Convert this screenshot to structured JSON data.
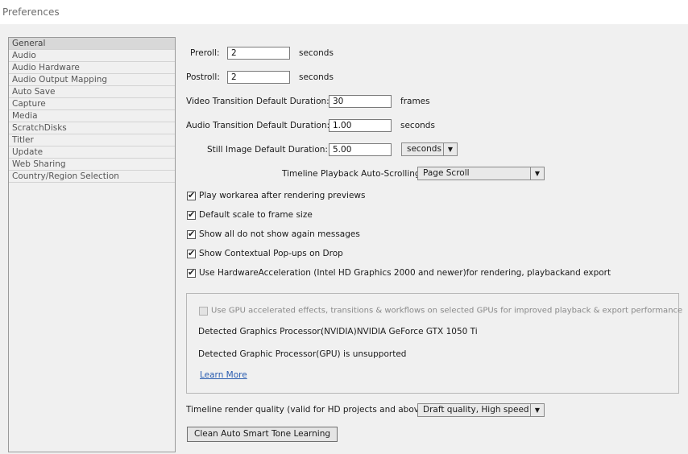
{
  "window": {
    "title": "Preferences"
  },
  "sidebar": {
    "items": [
      {
        "label": "General"
      },
      {
        "label": "Audio"
      },
      {
        "label": "Audio Hardware"
      },
      {
        "label": "Audio Output Mapping"
      },
      {
        "label": "Auto Save"
      },
      {
        "label": "Capture"
      },
      {
        "label": "Media"
      },
      {
        "label": "ScratchDisks"
      },
      {
        "label": "Titler"
      },
      {
        "label": "Update"
      },
      {
        "label": "Web Sharing"
      },
      {
        "label": "Country/Region Selection"
      }
    ],
    "selected": "General"
  },
  "general": {
    "preroll": {
      "label": "Preroll:",
      "value": "2",
      "unit": "seconds"
    },
    "postroll": {
      "label": "Postroll:",
      "value": "2",
      "unit": "seconds"
    },
    "video_transition": {
      "label": "Video Transition Default Duration:",
      "value": "30",
      "unit": "frames"
    },
    "audio_transition": {
      "label": "Audio Transition Default Duration:",
      "value": "1.00",
      "unit": "seconds"
    },
    "still_image": {
      "label": "Still Image Default Duration:",
      "value": "5.00",
      "unit_dropdown": "seconds"
    },
    "auto_scroll": {
      "label": "Timeline Playback Auto-Scrolling:",
      "value": "Page Scroll"
    },
    "checkboxes": [
      {
        "label": "Play workarea after rendering previews",
        "checked": true
      },
      {
        "label": "Default scale to frame size",
        "checked": true
      },
      {
        "label": "Show all do not show again messages",
        "checked": true
      },
      {
        "label": "Show Contextual Pop-ups on Drop",
        "checked": true
      },
      {
        "label": "Use HardwareAcceleration (Intel HD Graphics 2000 and newer)for rendering, playbackand export",
        "checked": true
      }
    ],
    "gpu": {
      "checkbox_label": "Use GPU accelerated effects, transitions & workflows on selected GPUs for improved playback & export performance",
      "checked": false,
      "detected_label": "Detected Graphics Processor:",
      "detected_value": "(NVIDIA)NVIDIA GeForce GTX 1050 Ti",
      "unsupported_text": "Detected Graphic Processor(GPU) is unsupported",
      "learn_more": "Learn More"
    },
    "render_quality": {
      "label": "Timeline render quality (valid for HD projects and above):",
      "value": "Draft quality, High speed"
    },
    "clean_button": "Clean Auto Smart Tone Learning"
  },
  "icons": {
    "checkmark": "checkmark-icon",
    "dropdown": "chevron-down-icon"
  }
}
